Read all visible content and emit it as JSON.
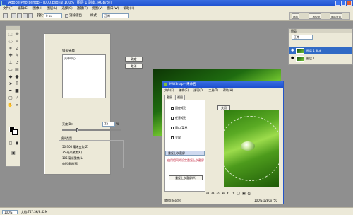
{
  "app": {
    "title": "Adobe Photoshop - [000.psd @ 100% (图层 1 副本, RGB/8)]"
  },
  "menu": [
    "文件(F)",
    "编辑(E)",
    "图像(I)",
    "图层(L)",
    "选择(S)",
    "滤镜(T)",
    "视图(V)",
    "窗口(W)",
    "帮助(H)"
  ],
  "options": {
    "feather_label": "羽化:",
    "feather_value": "0 px",
    "antialias_label": "消除锯齿",
    "style_label": "样式:",
    "style_value": "正常",
    "workspace_tabs": [
      "画笔",
      "工具预设",
      "图层复合"
    ]
  },
  "layers": {
    "title": "图层",
    "blend": "正常",
    "rows": [
      "图层 1 副本",
      "图层 1"
    ]
  },
  "lens_dialog": {
    "title": "镜头光晕",
    "list_label": "光晕中心:",
    "ok": "确定",
    "cancel": "取消",
    "brightness_label": "亮度(B):",
    "brightness_value": "72",
    "brightness_percent": 72,
    "percent": "%",
    "group_label": "镜头类型",
    "radios": [
      "50-300 毫米变焦(Z)",
      "35 毫米聚焦(K)",
      "105 毫米聚焦(L)",
      "电影镜头(M)"
    ]
  },
  "mwsnap": {
    "title": "MWSnap - 未命名",
    "menu": [
      "文件(F)",
      "编辑(E)",
      "选项(O)",
      "工具(T)",
      "帮助(H)"
    ],
    "tabs": [
      "截屏",
      "视图"
    ],
    "options": [
      "固定矩形",
      "任意矩形",
      "窗口/菜单",
      "全屏"
    ],
    "last_button": "重复上次截屏",
    "hint": "使用相同的设定重复上次截屏",
    "action": "重复上次截屏(A)",
    "close": "关闭",
    "status_left": "就绪(Ready)",
    "status_right": "100%        1280x750"
  },
  "status": {
    "zoom": "100%",
    "doc": "文档:747.3K/8.42M"
  }
}
